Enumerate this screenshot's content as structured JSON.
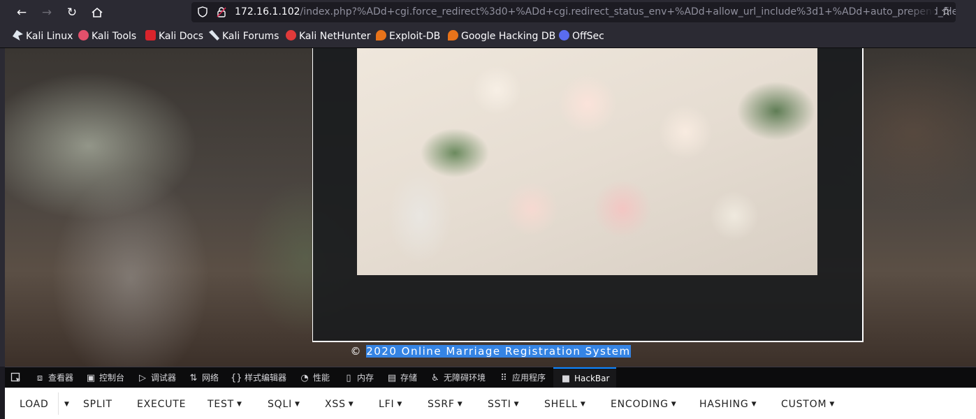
{
  "browser": {
    "url_host": "172.16.1.102",
    "url_rest": "/index.php?%ADd+cgi.force_redirect%3d0+%ADd+cgi.redirect_status_env+%ADd+allow_url_include%3d1+%ADd+auto_prepend_file",
    "bookmarks": [
      {
        "label": "Kali Linux",
        "icon": "kali-dragon-icon",
        "color": "#dfe6ee"
      },
      {
        "label": "Kali Tools",
        "icon": "kali-tools-icon",
        "color": "#e2506b"
      },
      {
        "label": "Kali Docs",
        "icon": "kali-docs-icon",
        "color": "#d9242c"
      },
      {
        "label": "Kali Forums",
        "icon": "kali-forums-icon",
        "color": "#dfe6ee"
      },
      {
        "label": "Kali NetHunter",
        "icon": "nethunter-icon",
        "color": "#e03a3a"
      },
      {
        "label": "Exploit-DB",
        "icon": "exploit-db-icon",
        "color": "#e8731a"
      },
      {
        "label": "Google Hacking DB",
        "icon": "ghdb-icon",
        "color": "#e8731a"
      },
      {
        "label": "OffSec",
        "icon": "offsec-icon",
        "color": "#5a6cf0"
      }
    ]
  },
  "page": {
    "footer_copyright": "©",
    "footer_text": "2020 Online Marriage Registration System"
  },
  "devtools": {
    "tabs": [
      {
        "label": "查看器",
        "icon": "inspector-icon"
      },
      {
        "label": "控制台",
        "icon": "console-icon"
      },
      {
        "label": "调试器",
        "icon": "debugger-icon"
      },
      {
        "label": "网络",
        "icon": "network-icon"
      },
      {
        "label": "样式编辑器",
        "icon": "style-editor-icon"
      },
      {
        "label": "性能",
        "icon": "performance-icon"
      },
      {
        "label": "内存",
        "icon": "memory-icon"
      },
      {
        "label": "存储",
        "icon": "storage-icon"
      },
      {
        "label": "无障碍环境",
        "icon": "accessibility-icon"
      },
      {
        "label": "应用程序",
        "icon": "application-icon"
      },
      {
        "label": "HackBar",
        "icon": "hackbar-icon"
      }
    ],
    "active_tab": "HackBar"
  },
  "hackbar": {
    "buttons": [
      "LOAD",
      "SPLIT",
      "EXECUTE",
      "TEST",
      "SQLI",
      "XSS",
      "LFI",
      "SSRF",
      "SSTI",
      "SHELL",
      "ENCODING",
      "HASHING",
      "CUSTOM"
    ]
  }
}
